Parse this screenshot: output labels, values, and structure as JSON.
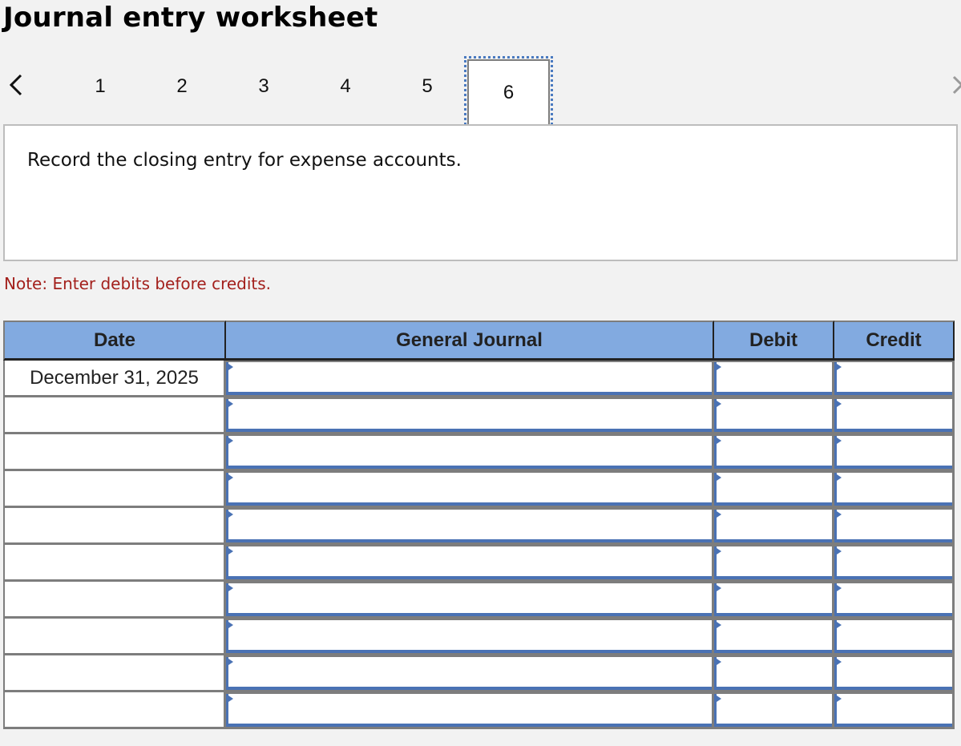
{
  "title": "Journal entry worksheet",
  "navigation": {
    "prev_icon": "chevron-left-icon",
    "next_icon": "chevron-right-icon",
    "steps": [
      "1",
      "2",
      "3",
      "4",
      "5",
      "6"
    ],
    "active_step": "6"
  },
  "prompt": "Record the closing entry for expense accounts.",
  "note": "Note: Enter debits before credits.",
  "colors": {
    "header_bg": "#82aae0",
    "note": "#a3201c",
    "input_accent": "#4a72b4",
    "focus_outline": "#4a7ac0"
  },
  "table": {
    "headers": {
      "date": "Date",
      "general_journal": "General Journal",
      "debit": "Debit",
      "credit": "Credit"
    },
    "rows": [
      {
        "date": "December 31, 2025",
        "account": "",
        "debit": "",
        "credit": ""
      },
      {
        "date": "",
        "account": "",
        "debit": "",
        "credit": ""
      },
      {
        "date": "",
        "account": "",
        "debit": "",
        "credit": ""
      },
      {
        "date": "",
        "account": "",
        "debit": "",
        "credit": ""
      },
      {
        "date": "",
        "account": "",
        "debit": "",
        "credit": ""
      },
      {
        "date": "",
        "account": "",
        "debit": "",
        "credit": ""
      },
      {
        "date": "",
        "account": "",
        "debit": "",
        "credit": ""
      },
      {
        "date": "",
        "account": "",
        "debit": "",
        "credit": ""
      },
      {
        "date": "",
        "account": "",
        "debit": "",
        "credit": ""
      },
      {
        "date": "",
        "account": "",
        "debit": "",
        "credit": ""
      }
    ]
  }
}
